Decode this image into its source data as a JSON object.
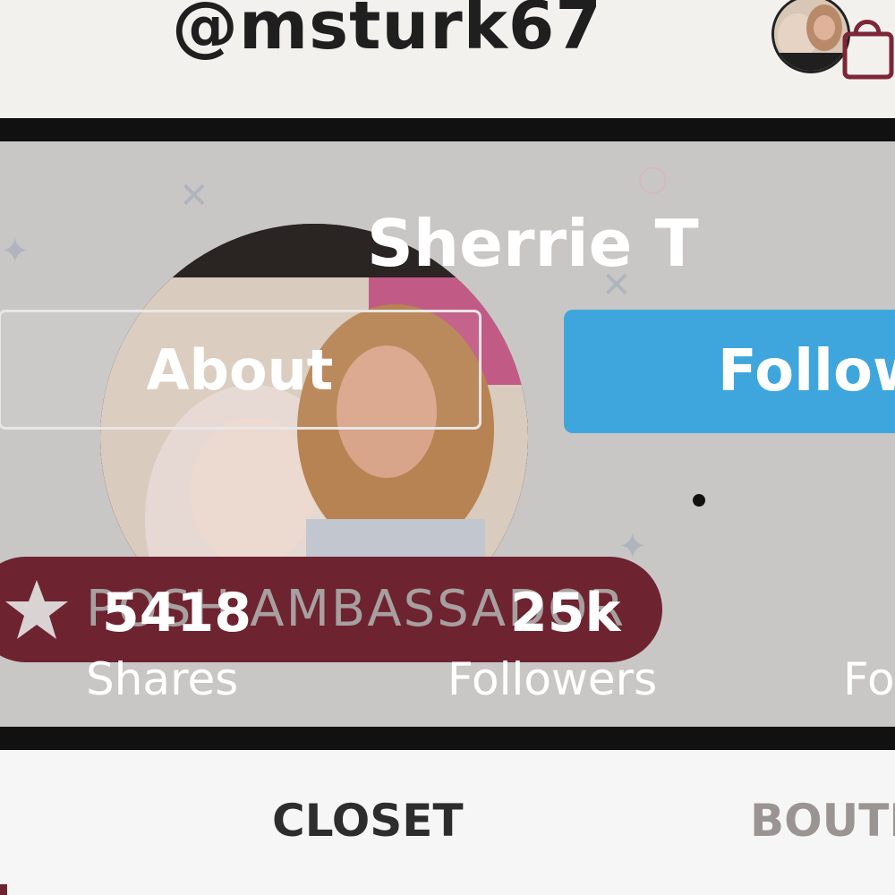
{
  "header": {
    "username": "@msturk67",
    "icons": [
      "avatar",
      "shopping-bag-icon"
    ]
  },
  "profile": {
    "display_name": "Sherrie T",
    "about_label": "About",
    "follow_label": "Follow",
    "badge_text": "POSH AMBASSADOR"
  },
  "stats": [
    {
      "value": "5418",
      "label": "Shares"
    },
    {
      "value": "25k",
      "label": "Followers"
    },
    {
      "value": "",
      "label": "Fo"
    }
  ],
  "tabs": [
    {
      "label": "CLOSET",
      "active": true
    },
    {
      "label": "BOUTI",
      "active": false
    }
  ],
  "colors": {
    "brand_maroon": "#6e2330",
    "follow_blue": "#3fa6dd",
    "header_bg": "#f3f1ee"
  }
}
